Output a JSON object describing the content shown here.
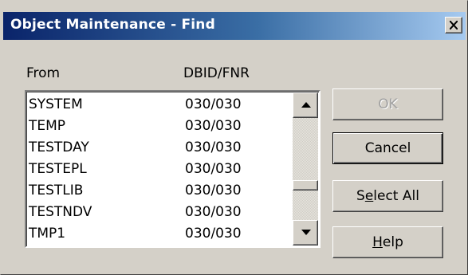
{
  "dialog": {
    "title": "Object Maintenance - Find",
    "close_glyph": "X"
  },
  "columns": {
    "from": "From",
    "dbid_fnr": "DBID/FNR"
  },
  "rows": [
    {
      "name": "SYSTEM",
      "dbid_fnr": "030/030"
    },
    {
      "name": "TEMP",
      "dbid_fnr": "030/030"
    },
    {
      "name": "TESTDAY",
      "dbid_fnr": "030/030"
    },
    {
      "name": "TESTEPL",
      "dbid_fnr": "030/030"
    },
    {
      "name": "TESTLIB",
      "dbid_fnr": "030/030"
    },
    {
      "name": "TESTNDV",
      "dbid_fnr": "030/030"
    },
    {
      "name": "TMP1",
      "dbid_fnr": "030/030"
    }
  ],
  "buttons": {
    "ok": {
      "label": "OK",
      "enabled": false
    },
    "cancel": {
      "label": "Cancel",
      "enabled": true,
      "default": true
    },
    "select_all": {
      "pre": "S",
      "mnemonic": "e",
      "post": "lect All",
      "enabled": true
    },
    "help": {
      "pre": "",
      "mnemonic": "H",
      "post": "elp",
      "enabled": true
    }
  },
  "scrollbar": {
    "position_fraction": 0.6
  },
  "colors": {
    "title_gradient_start": "#0a246a",
    "title_gradient_end": "#a6caf0",
    "face": "#d4d0c8"
  }
}
